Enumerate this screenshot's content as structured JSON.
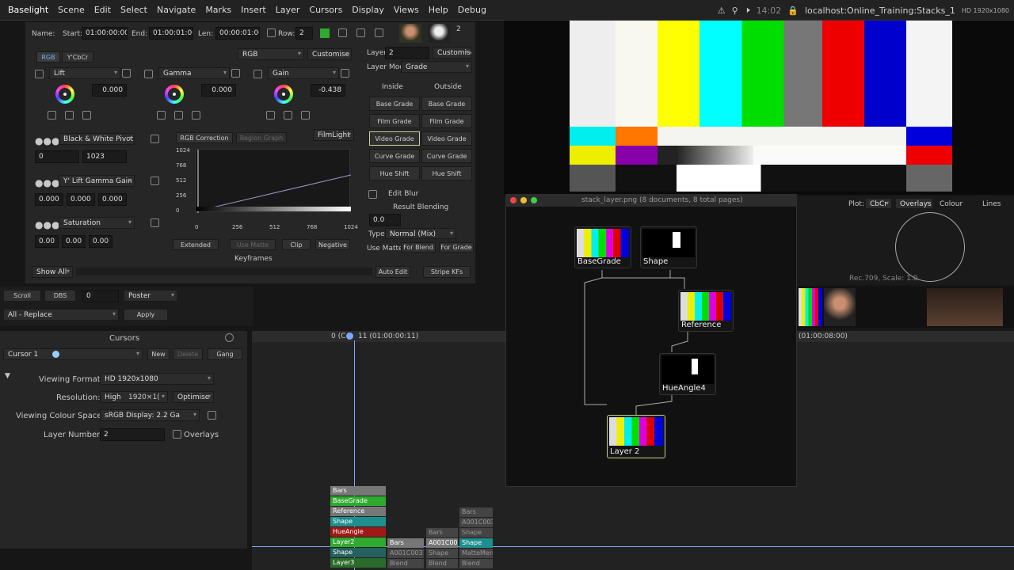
{
  "menu": [
    "Baselight",
    "Scene",
    "Edit",
    "Select",
    "Navigate",
    "Marks",
    "Insert",
    "Layer",
    "Cursors",
    "Display",
    "Views",
    "Help",
    "Debug"
  ],
  "status": {
    "time": "14:02",
    "host": "localhost:Online_Training:Stacks_1",
    "format": "HD 1920x1080"
  },
  "shot": {
    "name_label": "Name:",
    "start_label": "Start:",
    "start": "01:00:00:00",
    "end_label": "End:",
    "end": "01:00:01:00",
    "len_label": "Len:",
    "len": "00:00:01:00",
    "row_label": "Row:",
    "row": "2",
    "count": "2"
  },
  "grade_tabs": [
    "RGB",
    "Y'CbCr"
  ],
  "grade_mode": "RGB",
  "customise": "Customise",
  "wheels": [
    {
      "name": "Lift",
      "value": "0.000"
    },
    {
      "name": "Gamma",
      "value": "0.000"
    },
    {
      "name": "Gain",
      "value": "-0.438"
    }
  ],
  "bw_pivot": {
    "label": "Black & White Pivot",
    "low": "0",
    "high": "1023"
  },
  "lift_gamma_gain": {
    "label": "Y' Lift Gamma Gain",
    "v1": "0.000",
    "v2": "0.000",
    "v3": "0.000"
  },
  "saturation": {
    "label": "Saturation",
    "v1": "0.00",
    "v2": "0.00",
    "v3": "0.00"
  },
  "curve_tabs": [
    "RGB Correction",
    "Region Graph"
  ],
  "filmlight": "FilmLight",
  "curve_y": [
    "1024",
    "768",
    "512",
    "256",
    "0"
  ],
  "curve_x": [
    "0",
    "256",
    "512",
    "768",
    "1024"
  ],
  "curve_buttons": [
    "Extended",
    "Use Matte",
    "Clip",
    "Negative"
  ],
  "keyframes": "Keyframes",
  "show_all": "Show All",
  "auto_edit": "Auto Edit",
  "stripe": "Stripe KFs",
  "layer": {
    "label": "Layer:",
    "value": "2",
    "customise": "Customise",
    "mode_label": "Layer Mode",
    "mode": "Grade",
    "inside": "Inside",
    "outside": "Outside"
  },
  "grade_types": [
    "Base Grade",
    "Film Grade",
    "Video Grade",
    "Curve Grade",
    "Hue Shift"
  ],
  "edit_blur": "Edit Blur",
  "result_blending": "Result Blending",
  "blend_value": "0.0",
  "type_label": "Type:",
  "type_value": "Normal (Mix)",
  "use_matte": "Use Matte:",
  "for_blend": "For Blend",
  "for_grade": "For Grade",
  "scroll": "Scroll",
  "dbs": "DBS",
  "dbs_value": "0",
  "poster": "Poster",
  "replace": "All - Replace",
  "apply": "Apply",
  "cursors": {
    "title": "Cursors",
    "cursor": "Cursor 1",
    "new": "New",
    "delete": "Delete",
    "gang": "Gang"
  },
  "viewing": {
    "format_label": "Viewing Format:",
    "format": "HD 1920x1080",
    "res_label": "Resolution:",
    "res": "High",
    "res2": "1920×1(",
    "optimise": "Optimise",
    "cs_label": "Viewing Colour Space:",
    "cs": "sRGB Display: 2.2 Ga",
    "layer_label": "Layer Number:",
    "layer": "2",
    "overlays": "Overlays"
  },
  "timeline": {
    "left": "0 (C",
    "marker": "11 (01:00:00:11)",
    "right": "(01:00:08:00)"
  },
  "tracks": [
    "Bars",
    "BaseGrade",
    "Reference",
    "Shape",
    "HueAngle",
    "Layer2",
    "Shape",
    "Layer3"
  ],
  "tracks2": [
    "Bars",
    "A001C003",
    "Blend"
  ],
  "tracks3": [
    "Bars",
    "A001C003",
    "Shape",
    "Blend"
  ],
  "tracks4": [
    "Bars",
    "A001C003",
    "Shape",
    "Shape",
    "MatteMerg",
    "Blend"
  ],
  "node_window": {
    "title": "stack_layer.png (8 documents, 8 total pages)"
  },
  "nodes": [
    "BaseGrade",
    "Shape",
    "Reference",
    "HueAngle4",
    "Layer 2"
  ],
  "scope": {
    "plot_label": "Plot:",
    "plot": "CbCr",
    "overlays": "Overlays",
    "colour": "Colour",
    "lines": "Lines",
    "caption": "Rec.709, Scale: 1.0"
  },
  "colors": {
    "accent": "#3a6fd8",
    "green": "#2eaa2e",
    "teal": "#1e8f8f",
    "red": "#a01818"
  }
}
